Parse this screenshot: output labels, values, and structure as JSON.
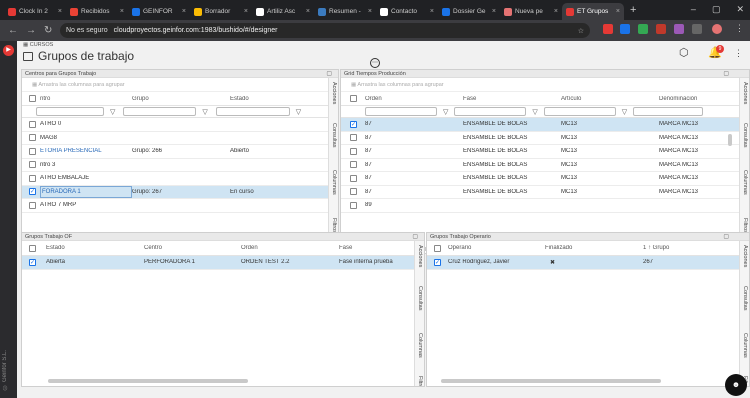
{
  "tabs": [
    {
      "label": "Clock In 2",
      "color": "#e53935",
      "active": false
    },
    {
      "label": "Recibidos",
      "color": "#ea4335",
      "active": false
    },
    {
      "label": "GEINFOR",
      "color": "#1a73e8",
      "active": false
    },
    {
      "label": "Borrador",
      "color": "#fbbc04",
      "active": false
    },
    {
      "label": "Artiliz Asc",
      "color": "#ffffff",
      "active": false
    },
    {
      "label": "Resumen -",
      "color": "#3b7bbf",
      "active": false
    },
    {
      "label": "Contacto",
      "color": "#ffffff",
      "active": false
    },
    {
      "label": "Dossier Ge",
      "color": "#1a73e8",
      "active": false
    },
    {
      "label": "Nueva pe",
      "color": "#e57373",
      "active": false
    },
    {
      "label": "ET Grupos",
      "color": "#e53935",
      "active": true
    }
  ],
  "address": {
    "security": "No es seguro",
    "url": "cloudproyectos.geinfor.com:1983/bushido/#/designer"
  },
  "app": {
    "breadcrumb": "CURSOS",
    "title": "Grupos de trabajo",
    "notif_count": "9"
  },
  "sidebar_text": "© Geinfor S.L.",
  "side_tabs": {
    "acciones": "Acciones",
    "consultas": "Consultas",
    "columnas": "Columnas",
    "filtros": "Filtros"
  },
  "panel1": {
    "title": "Centros para Grupos Trabajo",
    "group_hint": "Arrastra las columnas para agrupar",
    "columns": [
      "ntro",
      "Grupo",
      "Estado"
    ],
    "rows": [
      {
        "c1": "ATRO 0",
        "c2": "",
        "c3": "",
        "link": false,
        "sel": false
      },
      {
        "c1": "MAG8",
        "c2": "",
        "c3": "",
        "link": false,
        "sel": false
      },
      {
        "c1": "ETORIA PRESENCIAL",
        "c2": "Grupo: 266",
        "c3": "Abierto",
        "link": true,
        "sel": false
      },
      {
        "c1": "ntro 3",
        "c2": "",
        "c3": "",
        "link": false,
        "sel": false
      },
      {
        "c1": "ATRO EMBALAJE",
        "c2": "",
        "c3": "",
        "link": false,
        "sel": false
      },
      {
        "c1": "FORADORA 1",
        "c2": "Grupo: 267",
        "c3": "En curso",
        "link": true,
        "sel": true
      },
      {
        "c1": "ATRO 7 MRP",
        "c2": "",
        "c3": "",
        "link": false,
        "sel": false
      }
    ]
  },
  "panel2": {
    "title": "Grid Tiempos Producción",
    "group_hint": "Arrastra las columnas para agrupar",
    "columns": [
      "Orden",
      "Fase",
      "Artículo",
      "Denominación"
    ],
    "rows": [
      {
        "c1": "87",
        "c2": "ENSAMBLE DE BOLAS",
        "c3": "MC13",
        "c4": "MARCA MC13",
        "sel": true
      },
      {
        "c1": "87",
        "c2": "ENSAMBLE DE BOLAS",
        "c3": "MC13",
        "c4": "MARCA MC13",
        "sel": false
      },
      {
        "c1": "87",
        "c2": "ENSAMBLE DE BOLAS",
        "c3": "MC13",
        "c4": "MARCA MC13",
        "sel": false
      },
      {
        "c1": "87",
        "c2": "ENSAMBLE DE BOLAS",
        "c3": "MC13",
        "c4": "MARCA MC13",
        "sel": false
      },
      {
        "c1": "87",
        "c2": "ENSAMBLE DE BOLAS",
        "c3": "MC13",
        "c4": "MARCA MC13",
        "sel": false
      },
      {
        "c1": "87",
        "c2": "ENSAMBLE DE BOLAS",
        "c3": "MC13",
        "c4": "MARCA MC13",
        "sel": false
      },
      {
        "c1": "89",
        "c2": "",
        "c3": "",
        "c4": "",
        "sel": false
      }
    ]
  },
  "panel3": {
    "title": "Grupos Trabajo OF",
    "columns": [
      "Estado",
      "Centro",
      "Orden",
      "Fase"
    ],
    "rows": [
      {
        "c1": "Abierta",
        "c2": "PERFORADORA 1",
        "c3": "ORDEN TEST 2.2",
        "c4": "Fase interna prueba"
      }
    ]
  },
  "panel4": {
    "title": "Grupos Trabajo Operario",
    "columns": [
      "Operario",
      "Finalizado",
      "1 ↑ Grupo"
    ],
    "rows": [
      {
        "c1": "Cruz Rodríguez, Javier",
        "c2": "✖",
        "c3": "267"
      }
    ]
  }
}
